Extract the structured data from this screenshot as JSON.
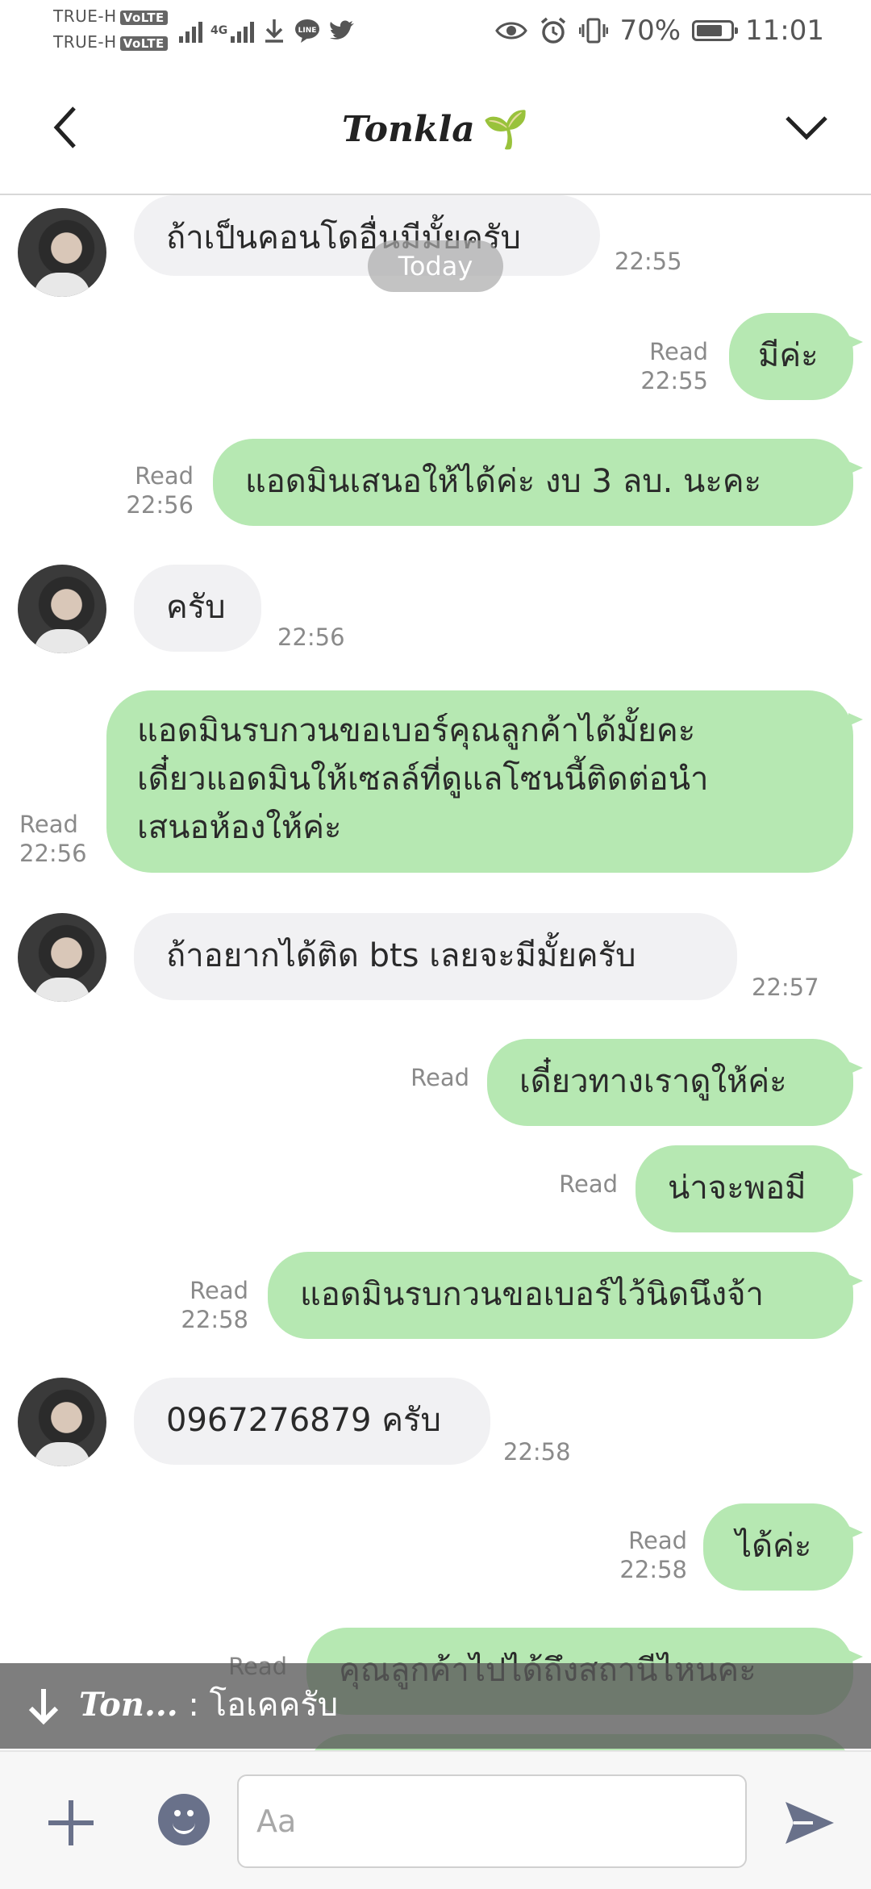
{
  "status_bar": {
    "carrier1": "TRUE-H",
    "carrier2": "TRUE-H",
    "volte": "VoLTE",
    "network": "4G",
    "battery": "70%",
    "time": "11:01"
  },
  "header": {
    "title": "Tonkla",
    "title_emoji": "🌱"
  },
  "date_chip": "Today",
  "messages": [
    {
      "side": "in",
      "text": "ถ้าเป็นคอนโดอื่นมีมั้ยครับ",
      "time": "22:55"
    },
    {
      "side": "out",
      "text": "มีค่ะ",
      "read": "Read",
      "time": "22:55"
    },
    {
      "side": "out",
      "text": "แอดมินเสนอให้ได้ค่ะ งบ 3 ลบ. นะคะ",
      "read": "Read",
      "time": "22:56"
    },
    {
      "side": "in",
      "text": "ครับ",
      "time": "22:56"
    },
    {
      "side": "out",
      "lines": [
        "แอดมินรบกวนขอเบอร์คุณลูกค้าได้มั้ยคะ",
        "เดี๋ยวแอดมินให้เซลล์ที่ดูแลโซนนี้ติดต่อนำ",
        "เสนอห้องให้ค่ะ"
      ],
      "read": "Read",
      "time": "22:56"
    },
    {
      "side": "in",
      "text": "ถ้าอยากได้ติด bts เลยจะมีมั้ยครับ",
      "time": "22:57"
    },
    {
      "side": "out",
      "text": "เดี๋ยวทางเราดูให้ค่ะ",
      "read": "Read",
      "time": ""
    },
    {
      "side": "out",
      "text": "น่าจะพอมี",
      "read": "Read",
      "time": ""
    },
    {
      "side": "out",
      "text": "แอดมินรบกวนขอเบอร์ไว้นิดนึงจ้า",
      "read": "Read",
      "time": "22:58"
    },
    {
      "side": "in",
      "text": "0967276879 ครับ",
      "time": "22:58"
    },
    {
      "side": "out",
      "text": "ได้ค่ะ",
      "read": "Read",
      "time": "22:58"
    },
    {
      "side": "out",
      "text": "คุณลูกค้าไปได้ถึงสถานีไหนคะ",
      "read": "Read",
      "time": ""
    }
  ],
  "notification": {
    "sender": "Ton...",
    "separator": " : ",
    "text": "โอเคครับ"
  },
  "input": {
    "placeholder": "Aa"
  },
  "colors": {
    "outgoing_bubble": "#b6e8b2",
    "incoming_bubble": "#f1f1f3",
    "icon_color": "#69718a"
  }
}
